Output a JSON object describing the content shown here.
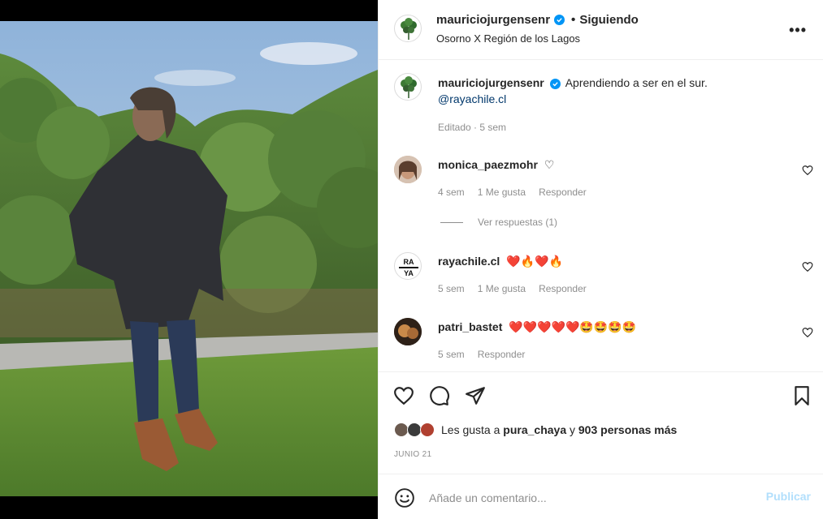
{
  "post": {
    "author": "mauriciojurgensenr",
    "separator": "•",
    "follow_status": "Siguiendo",
    "location": "Osorno X Región de los Lagos",
    "more_icon": "more-options-icon"
  },
  "caption": {
    "username": "mauriciojurgensenr",
    "text": "Aprendiendo a ser en el sur.",
    "mention": "@rayachile.cl",
    "meta": "Editado · 5 sem"
  },
  "comments": [
    {
      "username": "monica_paezmohr",
      "text": "♡",
      "time": "4 sem",
      "likes": "1 Me gusta",
      "reply": "Responder",
      "view_replies": "Ver respuestas (1)"
    },
    {
      "username": "rayachile.cl",
      "text": "❤️🔥❤️🔥",
      "time": "5 sem",
      "likes": "1 Me gusta",
      "reply": "Responder",
      "avatar_text_top": "RA",
      "avatar_text_bottom": "YA"
    },
    {
      "username": "patri_bastet",
      "text": "❤️❤️❤️❤️❤️🤩🤩🤩🤩",
      "time": "5 sem",
      "reply": "Responder"
    }
  ],
  "likes": {
    "prefix": "Les gusta a",
    "user": "pura_chaya",
    "conj": "y",
    "count": "903 personas más"
  },
  "date": "JUNIO 21",
  "comment_box": {
    "placeholder": "Añade un comentario...",
    "publish": "Publicar"
  },
  "colors": {
    "verified": "#0095f6",
    "publish_disabled": "#b2dffc",
    "heart": "#e0245e"
  }
}
